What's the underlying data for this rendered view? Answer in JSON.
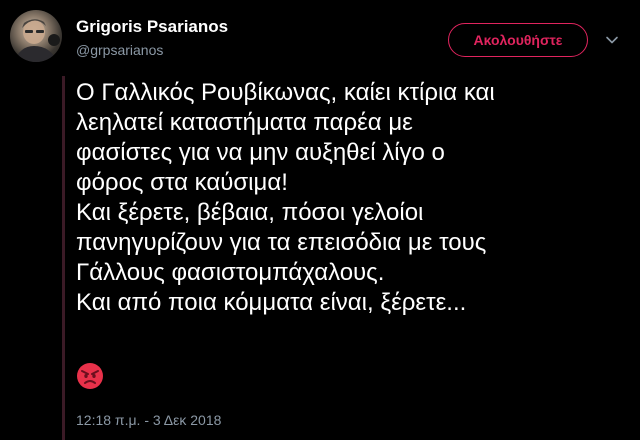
{
  "author": {
    "display_name": "Grigoris Psarianos",
    "handle": "@grpsarianos"
  },
  "actions": {
    "follow_label": "Ακολουθήστε"
  },
  "tweet": {
    "lines": [
      "Ο Γαλλικός Ρουβίκωνας, καίει κτίρια και",
      "λεηλατεί καταστήματα παρέα με",
      "φασίστες για να μην αυξηθεί λίγο ο",
      "φόρος στα καύσιμα!",
      "Και ξέρετε, βέβαια, πόσοι γελοίοι",
      "πανηγυρίζουν για τα επεισόδια με τους",
      "Γάλλους φασιστομπάχαλους.",
      "Και από ποια κόμματα είναι, ξέρετε..."
    ],
    "emoji": "angry-face-emoji",
    "timestamp": "12:18 π.μ. - 3 Δεκ 2018"
  },
  "colors": {
    "background": "#000000",
    "text": "#ffffff",
    "secondary_text": "#8b98a5",
    "accent": "#e0245e",
    "emoji_red": "#e8314a"
  }
}
